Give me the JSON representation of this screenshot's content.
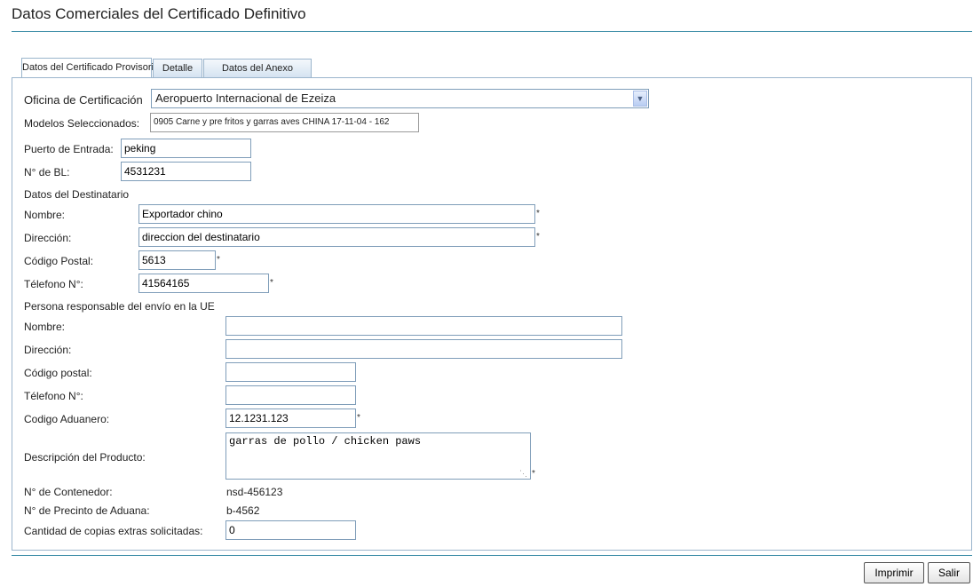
{
  "page": {
    "title": "Datos Comerciales del Certificado Definitivo"
  },
  "tabs": [
    {
      "label": "Datos del Certificado Provisorio",
      "active": true
    },
    {
      "label": "Detalle",
      "active": false
    },
    {
      "label": "Datos del Anexo",
      "active": false
    }
  ],
  "form": {
    "oficina": {
      "label": "Oficina de Certificación",
      "value": "Aeropuerto Internacional de Ezeiza"
    },
    "modelos": {
      "label": "Modelos Seleccionados:",
      "value": "0905 Carne y pre fritos y garras aves CHINA 17-11-04 - 162"
    },
    "puerto": {
      "label": "Puerto de Entrada:",
      "value": "peking"
    },
    "bl": {
      "label": "N° de BL:",
      "value": "4531231"
    },
    "destinatario": {
      "section": "Datos del Destinatario",
      "nombre": {
        "label": "Nombre:",
        "value": "Exportador chino"
      },
      "direccion": {
        "label": "Dirección:",
        "value": "direccion del destinatario"
      },
      "codigo_postal": {
        "label": "Código Postal:",
        "value": "5613"
      },
      "telefono": {
        "label": "Télefono N°:",
        "value": "41564165"
      }
    },
    "responsable": {
      "section": "Persona responsable del envío en la UE",
      "nombre": {
        "label": "Nombre:",
        "value": ""
      },
      "direccion": {
        "label": "Dirección:",
        "value": ""
      },
      "codigo_postal": {
        "label": "Código postal:",
        "value": ""
      },
      "telefono": {
        "label": "Télefono N°:",
        "value": ""
      },
      "codigo_aduanero": {
        "label": "Codigo Aduanero:",
        "value": "12.1231.123"
      }
    },
    "descripcion": {
      "label": "Descripción del Producto:",
      "value": "garras de pollo / chicken paws"
    },
    "contenedor": {
      "label": "N° de Contenedor:",
      "value": "nsd-456123"
    },
    "precinto": {
      "label": "N° de Precinto de Aduana:",
      "value": "b-4562"
    },
    "copias": {
      "label": "Cantidad de copias extras solicitadas:",
      "value": "0"
    },
    "required_mark": "*"
  },
  "buttons": {
    "imprimir": "Imprimir",
    "salir": "Salir"
  },
  "icons": {
    "select_arrow": "chevron-down-icon",
    "resize_grip": "resize-grip-icon"
  }
}
